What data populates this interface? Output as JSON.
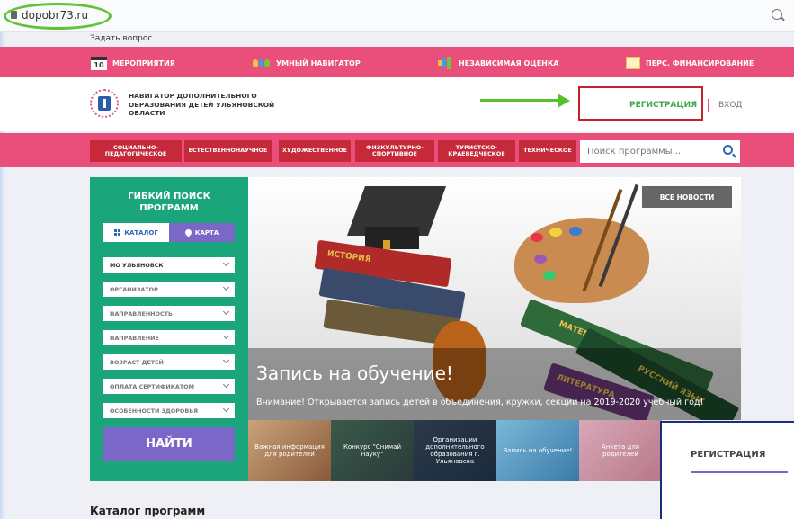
{
  "browser": {
    "url": "dopobr73.ru"
  },
  "ask_question": "Задать вопрос",
  "topnav": [
    {
      "label": "МЕРОПРИЯТИЯ",
      "icon": "calendar-icon",
      "icon_text": "10"
    },
    {
      "label": "УМНЫЙ НАВИГАТОР",
      "icon": "group-icon"
    },
    {
      "label": "НЕЗАВИСИМАЯ ОЦЕНКА",
      "icon": "bar-chart-icon"
    },
    {
      "label": "ПЕРС. ФИНАНСИРОВАНИЕ",
      "icon": "document-icon"
    }
  ],
  "header": {
    "brand_lines": [
      "НАВИГАТОР ДОПОЛНИТЕЛЬНОГО",
      "ОБРАЗОВАНИЯ ДЕТЕЙ УЛЬЯНОВСКОЙ",
      "ОБЛАСТИ"
    ],
    "register": "РЕГИСТРАЦИЯ",
    "login": "ВХОД"
  },
  "categories": [
    "СОЦИАЛЬНО-\nПЕДАГОГИЧЕСКОЕ",
    "ЕСТЕСТВЕННОНАУЧНОЕ",
    "ХУДОЖЕСТВЕННОЕ",
    "ФИЗКУЛЬТУРНО-\nСПОРТИВНОЕ",
    "ТУРИСТСКО-\nКРАЕВЕДЧЕСКОЕ",
    "ТЕХНИЧЕСКОЕ"
  ],
  "search": {
    "placeholder": "Поиск программы..."
  },
  "filter": {
    "title": "ГИБКИЙ ПОИСК ПРОГРАММ",
    "tab_catalog": "КАТАЛОГ",
    "tab_map": "КАРТА",
    "selects": [
      "МО УЛЬЯНОВСК",
      "ОРГАНИЗАТОР",
      "НАПРАВЛЕННОСТЬ",
      "НАПРАВЛЕНИЕ",
      "ВОЗРАСТ ДЕТЕЙ",
      "ОПЛАТА СЕРТИФИКАТОМ",
      "ОСОБЕННОСТИ ЗДОРОВЬЯ"
    ],
    "find_button": "НАЙТИ"
  },
  "hero": {
    "all_news": "ВСЕ НОВОСТИ",
    "title": "Запись на обучение!",
    "text": "Внимание! Открывается запись детей в объединения, кружки, секции на 2019-2020 учебный год!",
    "book_labels": [
      "ИСТОРИЯ",
      "МАТЕМАТИКА",
      "РУССКИЙ ЯЗЫК",
      "ЛИТЕРАТУРА"
    ]
  },
  "thumbnails": [
    {
      "label": "Важная информация для родителей"
    },
    {
      "label": "Конкурс \"Снимай науку\""
    },
    {
      "label": "Организации дополнительного образования г. Ульяновска"
    },
    {
      "label": "Запись на обучение!"
    },
    {
      "label": "Анкета для родителей"
    }
  ],
  "popup": {
    "title": "РЕГИСТРАЦИЯ"
  },
  "catalog_heading": "Каталог программ",
  "colors": {
    "pink": "#e94f7a",
    "red": "#c62a3a",
    "green": "#1aa57a",
    "purple": "#7a67c8",
    "register_green": "#3ea84a",
    "highlight_red": "#c8202a",
    "annotation_green": "#55c22d"
  }
}
